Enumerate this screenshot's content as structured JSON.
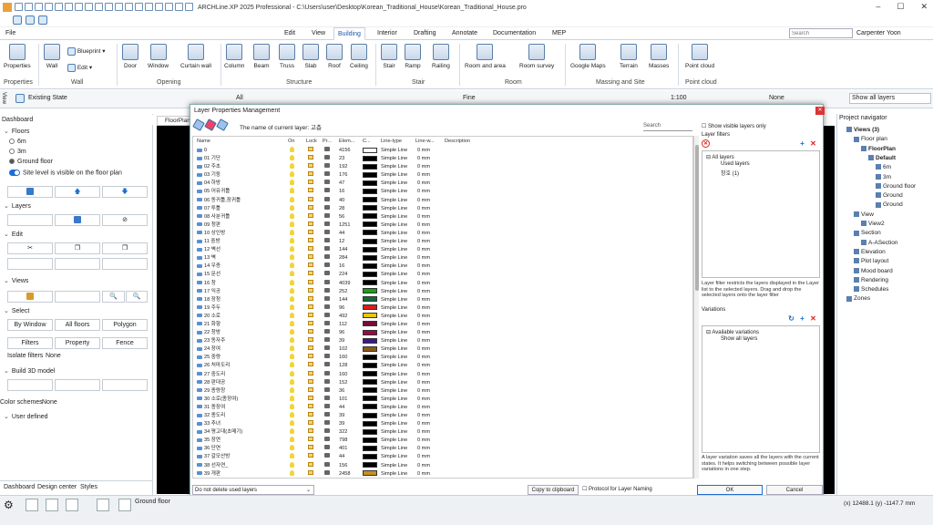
{
  "window": {
    "title": "ARCHLine.XP 2025 Professional - C:\\Users\\user\\Desktop\\Korean_Traditional_House\\Korean_Traditional_House.pro"
  },
  "menu": {
    "file": "File",
    "tabs": [
      "Edit",
      "View",
      "Building",
      "Interior",
      "Drafting",
      "Annotate",
      "Documentation",
      "MEP"
    ],
    "active": "Building",
    "search_placeholder": "Search",
    "user": "Carpenter Yoon"
  },
  "ribbon": {
    "buttons": [
      "Properties",
      "Wall",
      "Blueprint",
      "Edit",
      "Door",
      "Window",
      "Curtain wall",
      "Column",
      "Beam",
      "Truss",
      "Slab",
      "Roof",
      "Ceiling",
      "Stair",
      "Ramp",
      "Railing",
      "Room and area",
      "Room survey",
      "Google Maps",
      "Terrain",
      "Masses",
      "Point cloud"
    ],
    "groups": [
      "Properties",
      "Wall",
      "Opening",
      "Structure",
      "Stair",
      "Room",
      "Massing and Site",
      "Point cloud"
    ]
  },
  "toolbar2": {
    "view": "View",
    "state": "Existing State",
    "layer": "All",
    "line": "Fine",
    "scale": "1:100",
    "fill": "None",
    "show_layers": "Show all layers"
  },
  "left_panel": {
    "title": "Dashboard",
    "floors_label": "Floors",
    "floors": [
      "6m",
      "3m",
      "Ground floor"
    ],
    "site_visible": "Site level is visible on the floor plan",
    "layers": "Layers",
    "edit": "Edit",
    "views": "Views",
    "select": "Select",
    "select_buttons": [
      "By Window",
      "All floors",
      "Polygon",
      "Filters",
      "Property",
      "Fence"
    ],
    "isolate_label": "Isolate filters",
    "isolate_value": "None",
    "build3d": "Build 3D model",
    "color_label": "Color schemes",
    "color_value": "None",
    "user_defined": "User defined",
    "tabs": [
      "Dashboard",
      "Design center",
      "Styles"
    ]
  },
  "drawing_tab": "FloorPlan",
  "dialog": {
    "title": "Layer Properties Management",
    "current_layer": "The name of current layer: 고층",
    "search": "Search",
    "columns": [
      "Name",
      "On",
      "Lock",
      "Pr...",
      "Elem...",
      "C...",
      "Line-type",
      "Line-w...",
      "Description"
    ],
    "rows": [
      {
        "name": "0",
        "count": "4156",
        "color": "#ffffff"
      },
      {
        "name": "01 기단",
        "count": "23",
        "color": "#000000"
      },
      {
        "name": "02 주초",
        "count": "192",
        "color": "#000000"
      },
      {
        "name": "03 기둥",
        "count": "176",
        "color": "#000000"
      },
      {
        "name": "04 하방",
        "count": "47",
        "color": "#000000"
      },
      {
        "name": "05 어유귀틀",
        "count": "16",
        "color": "#000000"
      },
      {
        "name": "06 동귀틀,장귀틀",
        "count": "40",
        "color": "#000000"
      },
      {
        "name": "07 투틀",
        "count": "28",
        "color": "#000000"
      },
      {
        "name": "08 사분귀틀",
        "count": "56",
        "color": "#000000"
      },
      {
        "name": "09 청판",
        "count": "1251",
        "color": "#000000"
      },
      {
        "name": "10 상인방",
        "count": "44",
        "color": "#000000"
      },
      {
        "name": "11 중방",
        "count": "12",
        "color": "#000000"
      },
      {
        "name": "12 벽선",
        "count": "144",
        "color": "#000000"
      },
      {
        "name": "13 벽",
        "count": "284",
        "color": "#000000"
      },
      {
        "name": "14 우증",
        "count": "16",
        "color": "#000000"
      },
      {
        "name": "15 문선",
        "count": "224",
        "color": "#000000"
      },
      {
        "name": "16 창",
        "count": "4039",
        "color": "#000000"
      },
      {
        "name": "17 익공",
        "count": "252",
        "color": "#16a316"
      },
      {
        "name": "18 장청",
        "count": "144",
        "color": "#0f6b3a"
      },
      {
        "name": "19 주두",
        "count": "96",
        "color": "#e01a1a"
      },
      {
        "name": "20 소로",
        "count": "492",
        "color": "#e8c800"
      },
      {
        "name": "21 화향",
        "count": "112",
        "color": "#7a0a3a"
      },
      {
        "name": "22 창방",
        "count": "96",
        "color": "#9a0a4a"
      },
      {
        "name": "23 동자주",
        "count": "39",
        "color": "#3a1a8a"
      },
      {
        "name": "24 장여",
        "count": "102",
        "color": "#8a5a1a"
      },
      {
        "name": "25 중량",
        "count": "160",
        "color": "#000000"
      },
      {
        "name": "26 처마도리",
        "count": "128",
        "color": "#000000"
      },
      {
        "name": "27 중도리",
        "count": "160",
        "color": "#000000"
      },
      {
        "name": "28 판대공",
        "count": "152",
        "color": "#000000"
      },
      {
        "name": "29 종량창",
        "count": "36",
        "color": "#000000"
      },
      {
        "name": "30 소로(종장여)",
        "count": "101",
        "color": "#000000"
      },
      {
        "name": "31 종장여",
        "count": "44",
        "color": "#000000"
      },
      {
        "name": "32 종도리",
        "count": "39",
        "color": "#000000"
      },
      {
        "name": "33 추녀",
        "count": "39",
        "color": "#000000"
      },
      {
        "name": "34 평고대(초매기)",
        "count": "322",
        "color": "#000000"
      },
      {
        "name": "35 장연",
        "count": "798",
        "color": "#000000"
      },
      {
        "name": "36 단연",
        "count": "401",
        "color": "#000000"
      },
      {
        "name": "37 갈모산방",
        "count": "44",
        "color": "#000000"
      },
      {
        "name": "38 선자연_",
        "count": "156",
        "color": "#000000"
      },
      {
        "name": "39 개판",
        "count": "2458",
        "color": "#c8901a"
      }
    ],
    "linetype": "Simple Line",
    "lineweight": "0 mm",
    "show_visible": "Show visible layers only",
    "filters_label": "Layer filters",
    "filter_tree": [
      "All layers",
      "Used layers",
      "창호 (1)"
    ],
    "filter_desc": "Layer filter restricts the layers displayed in the Layer list to the selected layers. Drag and drop the selected layers onto the layer filter",
    "variations_label": "Variations",
    "variation_tree": [
      "Available variations",
      "Show all layers"
    ],
    "variation_desc": "A layer variation saves all the layers with the current states. It helps switching between possible layer variations in one step.",
    "footer_select": "Do not delete used layers",
    "copy_btn": "Copy to clipboard",
    "protocol": "Protocol for Layer Naming",
    "ok": "OK",
    "cancel": "Cancel"
  },
  "navigator": {
    "title": "Project navigator",
    "items": [
      {
        "label": "Views (3)",
        "x": 10,
        "bold": true
      },
      {
        "label": "Floor plan",
        "x": 18
      },
      {
        "label": "FloorPlan",
        "x": 26,
        "bold": true
      },
      {
        "label": "Default",
        "x": 34,
        "bold": true
      },
      {
        "label": "6m",
        "x": 42
      },
      {
        "label": "3m",
        "x": 42
      },
      {
        "label": "Ground floor",
        "x": 42
      },
      {
        "label": "Ground",
        "x": 42
      },
      {
        "label": "Ground",
        "x": 42
      },
      {
        "label": "View",
        "x": 18
      },
      {
        "label": "View2",
        "x": 26
      },
      {
        "label": "Section",
        "x": 18
      },
      {
        "label": "A-ASection",
        "x": 26
      },
      {
        "label": "Elevation",
        "x": 18
      },
      {
        "label": "Plot layout",
        "x": 18
      },
      {
        "label": "Mood board",
        "x": 18
      },
      {
        "label": "Rendering",
        "x": 18
      },
      {
        "label": "Schedules",
        "x": 18
      },
      {
        "label": "Zones",
        "x": 10
      }
    ]
  },
  "status": {
    "floor": "Ground floor",
    "coords": "(x) 12488.1  (y) -1147.7 mm"
  }
}
